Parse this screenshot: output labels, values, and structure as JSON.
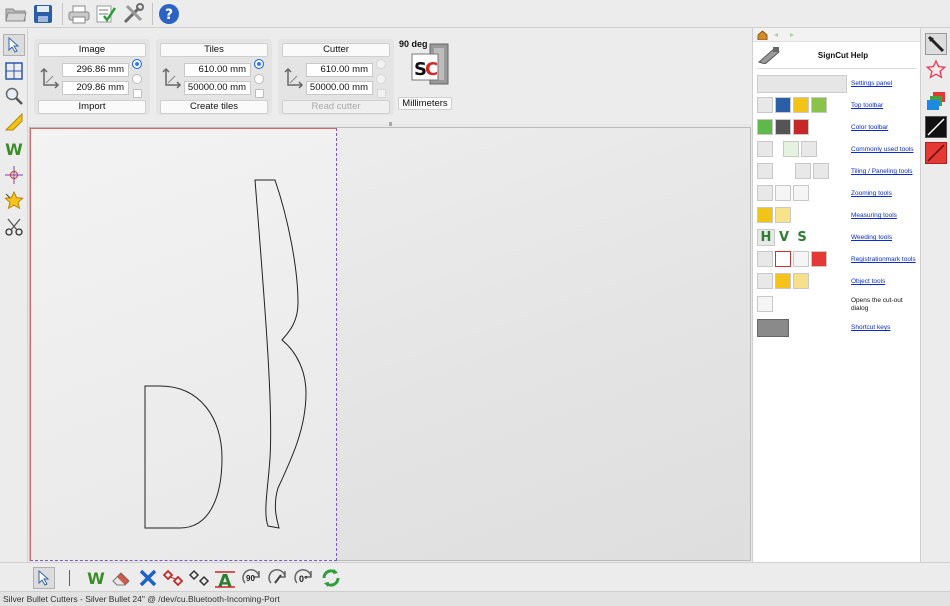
{
  "top_toolbar": {
    "icons": [
      "open-folder-icon",
      "save-icon",
      "print-icon",
      "checklist-icon",
      "tools-icon",
      "help-icon"
    ]
  },
  "left_toolbar": {
    "icons": [
      "pointer-icon",
      "selection-rectangle-icon",
      "zoom-icon",
      "measure-icon",
      "weed-icon",
      "registration-mark-icon",
      "object-star-icon",
      "cutout-scissors-icon"
    ]
  },
  "settings": {
    "image": {
      "button": "Image",
      "width": "296.86 mm",
      "height": "209.86 mm",
      "action": "Import"
    },
    "tiles": {
      "button": "Tiles",
      "width": "610.00 mm",
      "height": "50000.00 mm",
      "action": "Create tiles"
    },
    "cutter": {
      "button": "Cutter",
      "width": "610.00 mm",
      "height": "50000.00 mm",
      "action": "Read cutter"
    },
    "rotation": "90 deg",
    "units": "Millimeters"
  },
  "help": {
    "title": "SignCut Help",
    "rows": [
      {
        "label": "Settings panel",
        "type": "link"
      },
      {
        "label": "Top toolbar",
        "type": "link"
      },
      {
        "label": "Color toolbar",
        "type": "link"
      },
      {
        "label": "Commonly used tools",
        "type": "link"
      },
      {
        "label": "Tiling / Paneling tools",
        "type": "link"
      },
      {
        "label": "Zooming tools",
        "type": "link"
      },
      {
        "label": "Measuring tools",
        "type": "link"
      },
      {
        "label": "Weeding tools",
        "type": "link"
      },
      {
        "label": "Registrationmark tools",
        "type": "link"
      },
      {
        "label": "Object tools",
        "type": "link"
      },
      {
        "label": "Opens the cut-out dialog",
        "type": "text"
      },
      {
        "label": "Shortcut keys",
        "type": "link"
      }
    ],
    "weed_letters": [
      "H",
      "V",
      "S"
    ]
  },
  "right_toolbar": {
    "icons": [
      "color-picker-icon",
      "star-outline-icon",
      "color-layers-icon",
      "black-stroke-icon",
      "red-stroke-icon"
    ]
  },
  "bottom_toolbar": {
    "icons": [
      "pointer-icon",
      "weed-icon",
      "eraser-icon",
      "delete-x-icon",
      "red-diamonds-icon",
      "black-diamonds-icon",
      "text-a-icon",
      "rotate-90-icon",
      "rotate-free-icon",
      "rotate-0-icon",
      "refresh-icon"
    ],
    "rotate_90": "90",
    "rotate_0": "0°"
  },
  "status": "Silver Bullet Cutters - Silver Bullet 24\" @ /dev/cu.Bluetooth-Incoming-Port",
  "colors": {
    "accent_radio": "#2e7df6",
    "help_link": "#0a2bcf",
    "media_border": "#7a58c2"
  }
}
